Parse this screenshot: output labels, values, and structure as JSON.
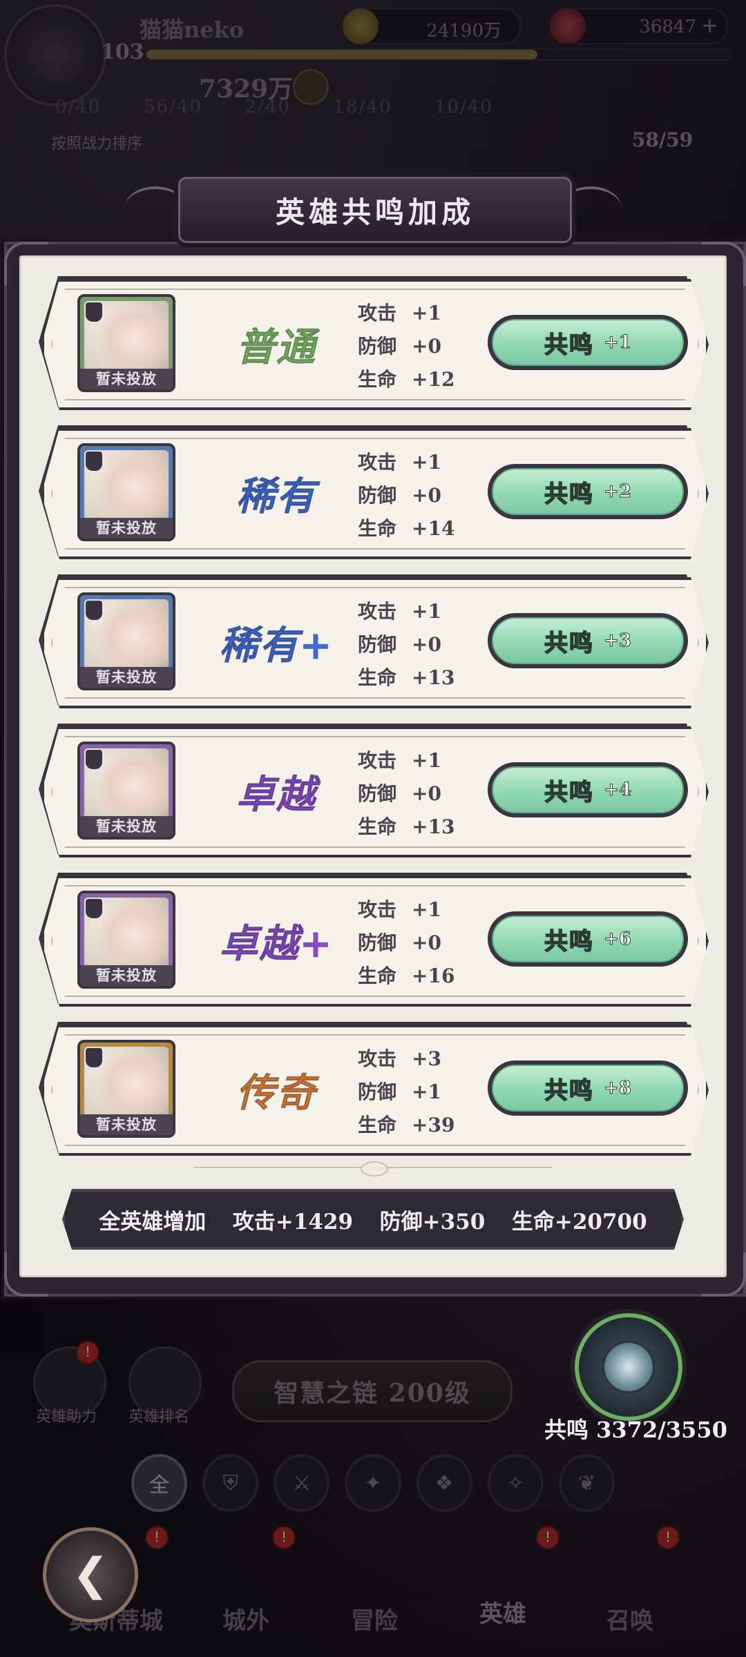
{
  "player": {
    "name": "猫猫neko",
    "level": "103",
    "power": "7329万",
    "xp_fraction": 0.67
  },
  "resources": {
    "gold": "24190万",
    "gems": "36847"
  },
  "background": {
    "sort_label": "按照战力排序",
    "hero_count": "58/59",
    "stat_counts": [
      "0/40",
      "56/40",
      "2/40",
      "18/40",
      "10/40"
    ],
    "chain_label": "智慧之链 200级",
    "side_buttons": [
      {
        "label": "英雄助力",
        "badge": "!"
      },
      {
        "label": "英雄排名",
        "badge": ""
      }
    ],
    "filter_all_label": "全",
    "nav_tabs": [
      {
        "label": "奥斯蒂城",
        "badge": "!"
      },
      {
        "label": "城外",
        "badge": "!"
      },
      {
        "label": "冒险",
        "badge": ""
      },
      {
        "label": "英雄",
        "badge": "!"
      },
      {
        "label": "召唤",
        "badge": "!"
      }
    ],
    "back_icon": "back-arrow-icon"
  },
  "resonance_orb": {
    "label": "共鸣 3372/3550",
    "ring_color": "#6ab060"
  },
  "modal": {
    "title": "英雄共鸣加成",
    "portrait_status": "暂未投放",
    "tiers": [
      {
        "name": "普通",
        "color": "#7cc45a",
        "stats": [
          {
            "label": "攻击",
            "value": "+1"
          },
          {
            "label": "防御",
            "value": "+0"
          },
          {
            "label": "生命",
            "value": "+12"
          }
        ],
        "button_label": "共鸣",
        "button_value": "+1",
        "frame": "#7a9a6a"
      },
      {
        "name": "稀有",
        "color": "#3c6ad8",
        "stats": [
          {
            "label": "攻击",
            "value": "+1"
          },
          {
            "label": "防御",
            "value": "+0"
          },
          {
            "label": "生命",
            "value": "+14"
          }
        ],
        "button_label": "共鸣",
        "button_value": "+2",
        "frame": "#5a78b0"
      },
      {
        "name": "稀有+",
        "color": "#3c6ad8",
        "stats": [
          {
            "label": "攻击",
            "value": "+1"
          },
          {
            "label": "防御",
            "value": "+0"
          },
          {
            "label": "生命",
            "value": "+13"
          }
        ],
        "button_label": "共鸣",
        "button_value": "+3",
        "frame": "#5a78b0"
      },
      {
        "name": "卓越",
        "color": "#8a48d0",
        "stats": [
          {
            "label": "攻击",
            "value": "+1"
          },
          {
            "label": "防御",
            "value": "+0"
          },
          {
            "label": "生命",
            "value": "+13"
          }
        ],
        "button_label": "共鸣",
        "button_value": "+4",
        "frame": "#8a62a8"
      },
      {
        "name": "卓越+",
        "color": "#8a48d0",
        "stats": [
          {
            "label": "攻击",
            "value": "+1"
          },
          {
            "label": "防御",
            "value": "+0"
          },
          {
            "label": "生命",
            "value": "+16"
          }
        ],
        "button_label": "共鸣",
        "button_value": "+6",
        "frame": "#8a62a8"
      },
      {
        "name": "传奇",
        "color": "#e8802a",
        "stats": [
          {
            "label": "攻击",
            "value": "+3"
          },
          {
            "label": "防御",
            "value": "+1"
          },
          {
            "label": "生命",
            "value": "+39"
          }
        ],
        "button_label": "共鸣",
        "button_value": "+8",
        "frame": "#b08a40"
      }
    ],
    "totals": {
      "label": "全英雄增加",
      "attack": "攻击+1429",
      "defense": "防御+350",
      "hp": "生命+20700"
    }
  }
}
